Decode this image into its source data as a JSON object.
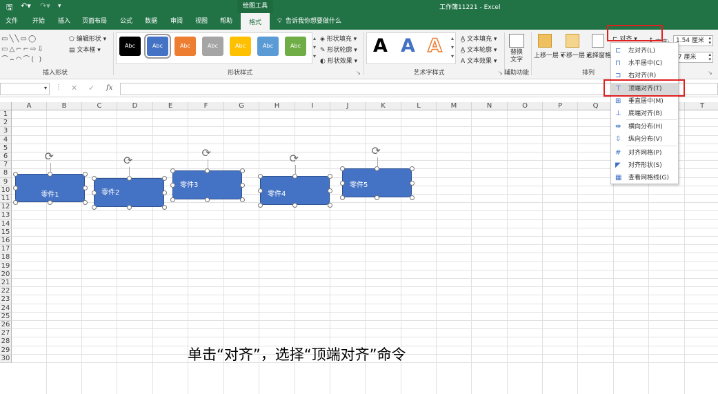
{
  "title_bar": {
    "context_tool": "绘图工具",
    "doc_title": "工作簿11221 - Excel"
  },
  "tabs": [
    "文件",
    "开始",
    "插入",
    "页面布局",
    "公式",
    "数据",
    "审阅",
    "视图",
    "帮助",
    "格式"
  ],
  "tell_me": "告诉我你想要做什么",
  "insert_shapes": {
    "edit_shape": "编辑形状",
    "text_box": "文本框",
    "group_label": "插入形状"
  },
  "shape_styles": {
    "thumb_label": "Abc",
    "group_label": "形状样式",
    "fill": "形状填充",
    "outline": "形状轮廓",
    "effects": "形状效果"
  },
  "wordart": {
    "glyph": "A",
    "group_label": "艺术字样式",
    "text_fill": "文本填充",
    "text_outline": "文本轮廓",
    "text_effects": "文本效果"
  },
  "accessibility": {
    "alt_text_line1": "替换",
    "alt_text_line2": "文字",
    "group_label": "辅助功能"
  },
  "arrange": {
    "bring_forward": "上移一层",
    "send_backward": "下移一层",
    "selection_pane": "选择窗格",
    "align": "对齐",
    "group_label": "排列"
  },
  "size": {
    "height_label": "高度:",
    "height_value": "1.54 厘米",
    "width_value": ".7 厘米"
  },
  "columns": [
    "A",
    "B",
    "C",
    "D",
    "E",
    "F",
    "G",
    "H",
    "I",
    "J",
    "K",
    "L",
    "M",
    "N",
    "O",
    "P",
    "Q",
    "R",
    "S",
    "T"
  ],
  "rows": [
    "1",
    "2",
    "3",
    "4",
    "5",
    "6",
    "7",
    "8",
    "9",
    "10",
    "11",
    "12",
    "13",
    "14",
    "15",
    "16",
    "17",
    "18",
    "19",
    "20",
    "21",
    "22",
    "23",
    "24",
    "25",
    "26",
    "27",
    "28",
    "29",
    "30"
  ],
  "shapes": [
    "零件1",
    "零件2",
    "零件3",
    "零件4",
    "零件5"
  ],
  "align_menu": [
    "左对齐(L)",
    "水平居中(C)",
    "右对齐(R)",
    "顶端对齐(T)",
    "垂直居中(M)",
    "底端对齐(B)",
    "横向分布(H)",
    "纵向分布(V)",
    "对齐网格(P)",
    "对齐形状(S)",
    "查看网格线(G)"
  ],
  "caption": "单击“对齐”，选择“顶端对齐”命令",
  "colors": {
    "brand": "#217346",
    "shape_fill": "#4472c4",
    "highlight": "#e02020"
  }
}
